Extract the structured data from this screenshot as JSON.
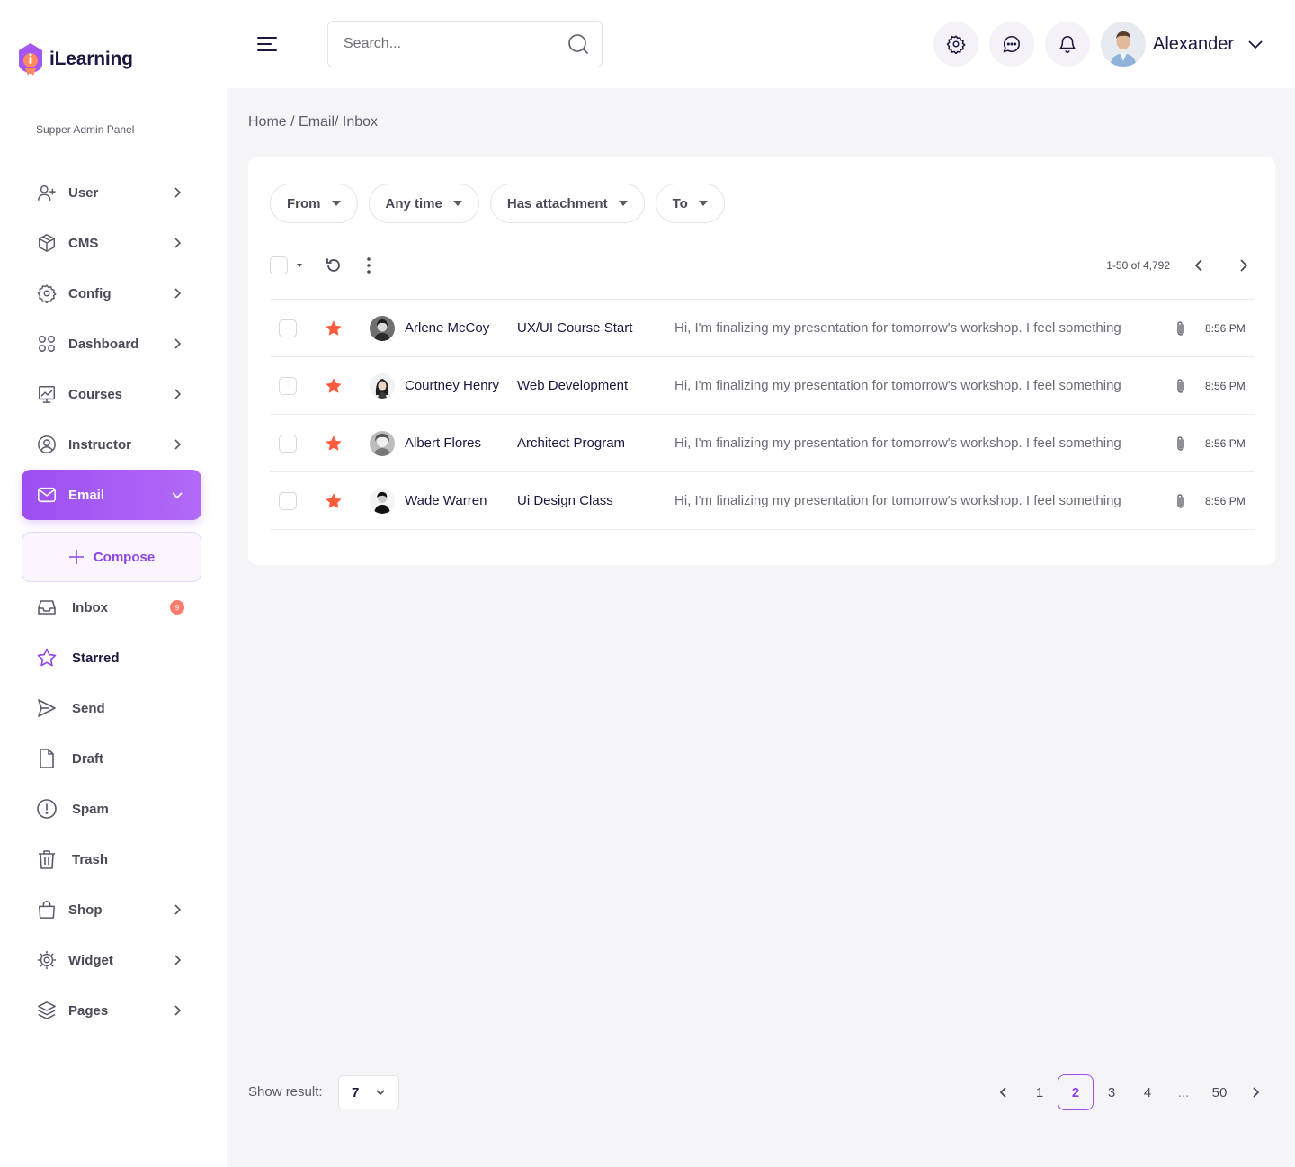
{
  "app": {
    "name": "iLearning",
    "panel_label": "Supper Admin Panel"
  },
  "sidebar": {
    "items": [
      {
        "label": "User",
        "icon": "user-plus-icon"
      },
      {
        "label": "CMS",
        "icon": "box-icon"
      },
      {
        "label": "Config",
        "icon": "gear-icon"
      },
      {
        "label": "Dashboard",
        "icon": "grid-icon"
      },
      {
        "label": "Courses",
        "icon": "chart-icon"
      },
      {
        "label": "Instructor",
        "icon": "user-circle-icon"
      },
      {
        "label": "Email",
        "icon": "mail-icon",
        "active": true
      }
    ],
    "compose_label": "Compose",
    "email_sub": [
      {
        "label": "Inbox",
        "badge": "9"
      },
      {
        "label": "Starred"
      },
      {
        "label": "Send"
      },
      {
        "label": "Draft"
      },
      {
        "label": "Spam"
      },
      {
        "label": "Trash"
      }
    ],
    "items_after": [
      {
        "label": "Shop"
      },
      {
        "label": "Widget"
      },
      {
        "label": "Pages"
      }
    ]
  },
  "header": {
    "search_placeholder": "Search...",
    "user_name": "Alexander"
  },
  "breadcrumb": "Home / Email/ Inbox",
  "filters": [
    "From",
    "Any time",
    "Has attachment",
    "To"
  ],
  "toolbar": {
    "range": "1-50 of 4,792"
  },
  "mails": [
    {
      "sender": "Arlene McCoy",
      "subject": "UX/UI Course Start",
      "preview": "Hi, I'm finalizing my presentation for tomorrow's workshop. I feel something",
      "time": "8:56 PM"
    },
    {
      "sender": "Courtney Henry",
      "subject": "Web Development",
      "preview": "Hi, I'm finalizing my presentation for tomorrow's workshop. I feel something",
      "time": "8:56 PM"
    },
    {
      "sender": "Albert Flores",
      "subject": "Architect Program",
      "preview": "Hi, I'm finalizing my presentation for tomorrow's workshop. I feel something",
      "time": "8:56 PM"
    },
    {
      "sender": "Wade Warren",
      "subject": "Ui Design Class",
      "preview": "Hi, I'm finalizing my presentation for tomorrow's workshop. I feel something",
      "time": "8:56 PM"
    }
  ],
  "footer": {
    "show_result_label": "Show result:",
    "show_result_value": "7",
    "pages": [
      "1",
      "2",
      "3",
      "4",
      "...",
      "50"
    ],
    "current_page": "2"
  },
  "colors": {
    "accent": "#9c4ef0",
    "star": "#ff5a3c",
    "badge": "#ff7b6b"
  }
}
